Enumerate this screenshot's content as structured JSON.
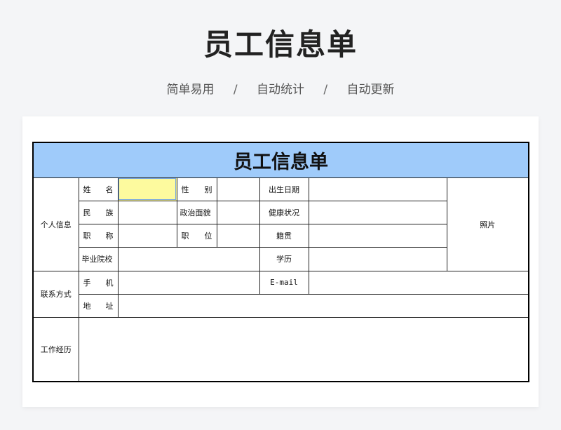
{
  "page": {
    "title": "员工信息单",
    "subtitle": [
      "简单易用",
      "自动统计",
      "自动更新"
    ],
    "separator": "/"
  },
  "form": {
    "header": "员工信息单",
    "sections": {
      "personal": "个人信息",
      "contact": "联系方式",
      "work": "工作经历"
    },
    "labels": {
      "name": "姓名",
      "gender": "性别",
      "birth": "出生日期",
      "ethnicity": "民族",
      "political": "政治面貌",
      "health": "健康状况",
      "title": "职称",
      "position": "职位",
      "native": "籍贯",
      "school": "毕业院校",
      "education": "学历",
      "phone": "手机",
      "email": "E-mail",
      "address": "地址",
      "photo": "照片"
    },
    "values": {
      "name": "",
      "gender": "",
      "birth": "",
      "ethnicity": "",
      "political": "",
      "health": "",
      "title": "",
      "position": "",
      "native": "",
      "school": "",
      "education": "",
      "phone": "",
      "email": "",
      "address": "",
      "work": ""
    },
    "colors": {
      "header_bg": "#9fcbfa",
      "selected_cell": "#fdfa9e"
    }
  }
}
